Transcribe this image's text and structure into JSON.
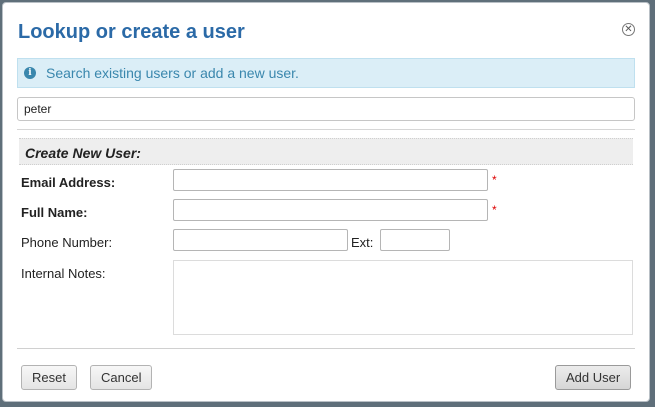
{
  "dialog": {
    "title": "Lookup or create a user",
    "close_icon": "close-circle-icon"
  },
  "info": {
    "icon": "info-icon",
    "text": "Search existing users or add a new user."
  },
  "search": {
    "value": "peter"
  },
  "create_section": {
    "header": "Create New User:",
    "email_label": "Email Address:",
    "fullname_label": "Full Name:",
    "phone_label": "Phone Number:",
    "ext_label": "Ext:",
    "notes_label": "Internal Notes:",
    "required_mark": "*",
    "email_value": "",
    "fullname_value": "",
    "phone_value": "",
    "ext_value": "",
    "notes_value": ""
  },
  "buttons": {
    "reset": "Reset",
    "cancel": "Cancel",
    "add_user": "Add User"
  },
  "colors": {
    "title": "#2b6aa7",
    "info_bg": "#dbeef7",
    "info_text": "#3a87ad",
    "required": "#dd0000"
  }
}
